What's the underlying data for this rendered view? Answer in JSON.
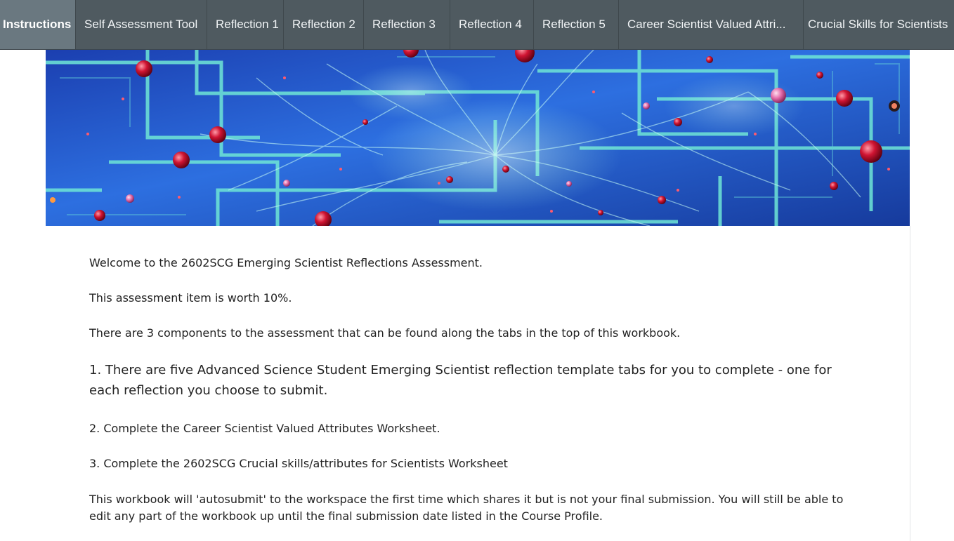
{
  "tabs": [
    {
      "label": "Instructions",
      "active": true
    },
    {
      "label": "Self Assessment Tool",
      "active": false
    },
    {
      "label": "Reflection 1",
      "active": false
    },
    {
      "label": "Reflection 2",
      "active": false
    },
    {
      "label": "Reflection 3",
      "active": false
    },
    {
      "label": "Reflection 4",
      "active": false
    },
    {
      "label": "Reflection 5",
      "active": false
    },
    {
      "label": "Career Scientist Valued Attri...",
      "active": false
    },
    {
      "label": "Crucial Skills for Scientists",
      "active": false
    }
  ],
  "colors": {
    "tabbar_bg": "#4f5a60",
    "tab_active_bg": "#6a7880",
    "banner_blue": "#1d4fc4",
    "banner_glow": "#9ff0e6",
    "orb_red": "#c8102e"
  },
  "content": {
    "welcome": "Welcome to the 2602SCG Emerging Scientist Reflections Assessment.",
    "worth": "This assessment item is worth 10%.",
    "components": "There are 3 components to the assessment that can be found along the tabs in the top of this workbook.",
    "item1": "1. There are five Advanced Science Student Emerging Scientist reflection template tabs for you to complete - one for each reflection you choose to submit.",
    "item2": "2. Complete the Career Scientist Valued Attributes Worksheet.",
    "item3": "3. Complete the 2602SCG Crucial skills/attributes for Scientists Worksheet",
    "autosubmit": "This workbook will 'autosubmit' to the workspace the first time which shares it but is not your final submission.  You will still be able to edit any part of the workbook up until the final submission date listed in the Course Profile."
  }
}
